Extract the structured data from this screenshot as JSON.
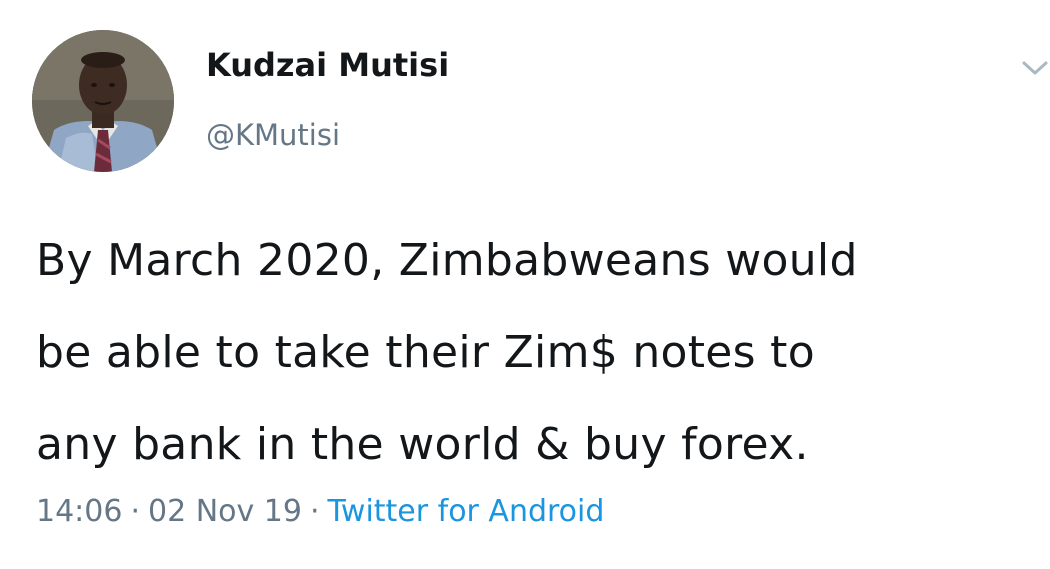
{
  "tweet": {
    "author": {
      "display_name": "Kudzai Mutisi",
      "handle": "@KMutisi"
    },
    "text_lines": [
      "By March 2020, Zimbabweans would",
      "be able to take their Zim$ notes to",
      "any bank in the world & buy forex."
    ],
    "meta": {
      "time": "14:06",
      "date": "02 Nov 19",
      "separator": "·",
      "source": "Twitter for Android"
    },
    "menu_icon": "chevron-down-icon"
  },
  "colors": {
    "text": "#14171a",
    "secondary": "#657786",
    "link": "#1b95e0",
    "background": "#ffffff"
  }
}
